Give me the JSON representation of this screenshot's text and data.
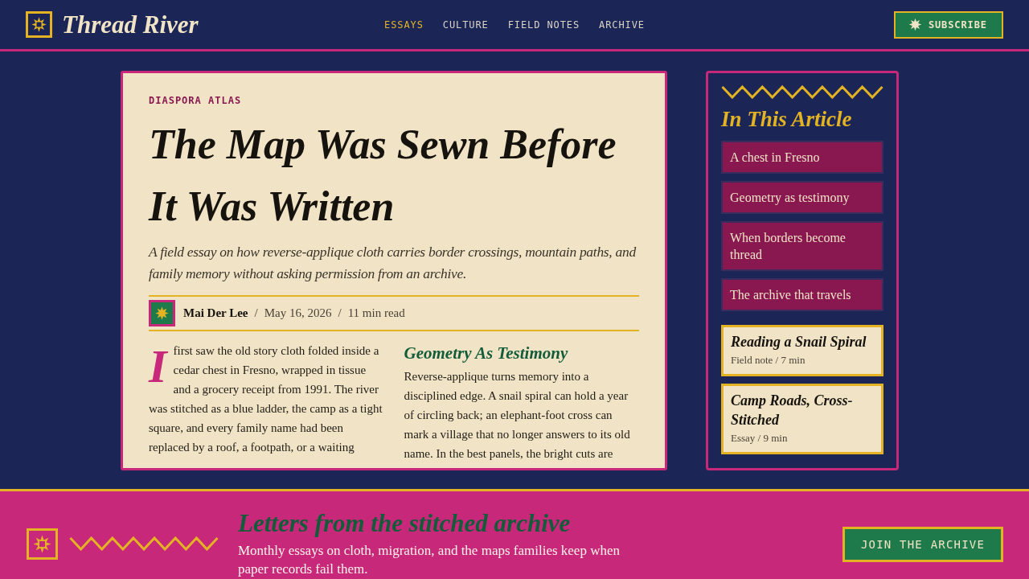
{
  "header": {
    "site_name": "Thread River",
    "nav": [
      {
        "label": "ESSAYS",
        "selected": true
      },
      {
        "label": "CULTURE",
        "selected": false
      },
      {
        "label": "FIELD NOTES",
        "selected": false
      },
      {
        "label": "ARCHIVE",
        "selected": false
      }
    ],
    "subscribe_button": "SUBSCRIBE"
  },
  "article": {
    "kicker": "DIASPORA ATLAS",
    "title": "The Map Was Sewn Before It Was Written",
    "subtitle": "A field essay on how reverse-applique cloth carries border crossings, mountain paths, and family memory without asking permission from an archive.",
    "byline": [
      {
        "kind": "author",
        "text": "Mai Der Lee"
      },
      {
        "kind": "separator",
        "text": "/"
      },
      {
        "kind": "date",
        "text": "May 16, 2026"
      },
      {
        "kind": "separator",
        "text": "/"
      },
      {
        "kind": "read_time",
        "text": "11 min read"
      }
    ],
    "columns": [
      {
        "paragraphs": [
          "I first saw the old story cloth folded inside a cedar chest in Fresno, wrapped in tissue and a grocery receipt from 1991. The river was stitched as a blue ladder, the camp as a tight square, and every family name had been replaced by a roof, a footpath, or a waiting"
        ]
      },
      {
        "heading": "Geometry As Testimony",
        "paragraphs": [
          "Reverse-applique turns memory into a disciplined edge. A snail spiral can hold a year of circling back; an elephant-foot cross can mark a village that no longer answers to its old name. In the best panels, the bright cuts are"
        ]
      }
    ]
  },
  "sidebar": {
    "title": "In This Article",
    "toc": [
      "A chest in Fresno",
      "Geometry as testimony",
      "When borders become thread",
      "The archive that travels"
    ],
    "cards": [
      {
        "title": "Reading a Snail Spiral",
        "meta": "Field note / 7 min"
      },
      {
        "title": "Camp Roads, Cross-Stitched",
        "meta": "Essay / 9 min"
      }
    ]
  },
  "newsletter": {
    "heading": "Letters from the stitched archive",
    "text": "Monthly essays on cloth, migration, and the maps families keep when paper records fail them.",
    "button": "JOIN THE ARCHIVE"
  }
}
